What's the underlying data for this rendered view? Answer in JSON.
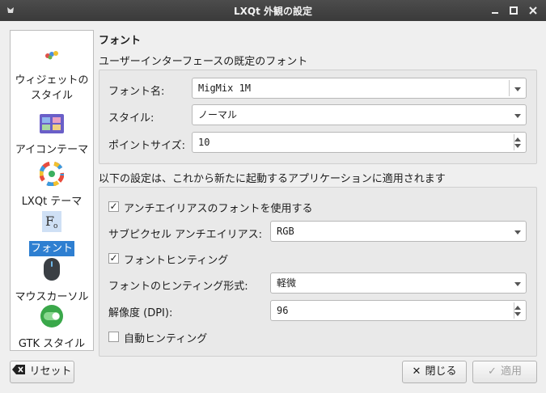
{
  "window": {
    "title": "LXQt 外観の設定"
  },
  "sidebar": {
    "items": [
      {
        "label": "ウィジェットの\nスタイル",
        "icon": "widget-style-icon"
      },
      {
        "label": "アイコンテーマ",
        "icon": "icon-theme-icon"
      },
      {
        "label": "LXQt テーマ",
        "icon": "lxqt-theme-icon"
      },
      {
        "label": "フォント",
        "icon": "font-icon",
        "selected": true
      },
      {
        "label": "マウスカーソル",
        "icon": "mouse-cursor-icon"
      },
      {
        "label": "GTK スタイル",
        "icon": "gtk-style-icon"
      }
    ]
  },
  "page": {
    "heading": "フォント",
    "default_font_section": "ユーザーインターフェースの既定のフォント",
    "font_name_label": "フォント名:",
    "font_name_value": "MigMix 1M",
    "style_label": "スタイル:",
    "style_value": "ノーマル",
    "point_size_label": "ポイントサイズ:",
    "point_size_value": "10",
    "new_apps_section": "以下の設定は、これから新たに起動するアプリケーションに適用されます",
    "antialias_label": "アンチエイリアスのフォントを使用する",
    "antialias_checked": true,
    "subpixel_label": "サブピクセル アンチエイリアス:",
    "subpixel_value": "RGB",
    "hinting_label": "フォントヒンティング",
    "hinting_checked": true,
    "hint_style_label": "フォントのヒンティング形式:",
    "hint_style_value": "軽微",
    "dpi_label": "解像度 (DPI):",
    "dpi_value": "96",
    "autohint_label": "自動ヒンティング",
    "autohint_checked": false
  },
  "buttons": {
    "reset": "リセット",
    "close": "閉じる",
    "apply": "適用"
  },
  "colors": {
    "selection": "#2e7fd1",
    "titlebar": "#404040"
  }
}
